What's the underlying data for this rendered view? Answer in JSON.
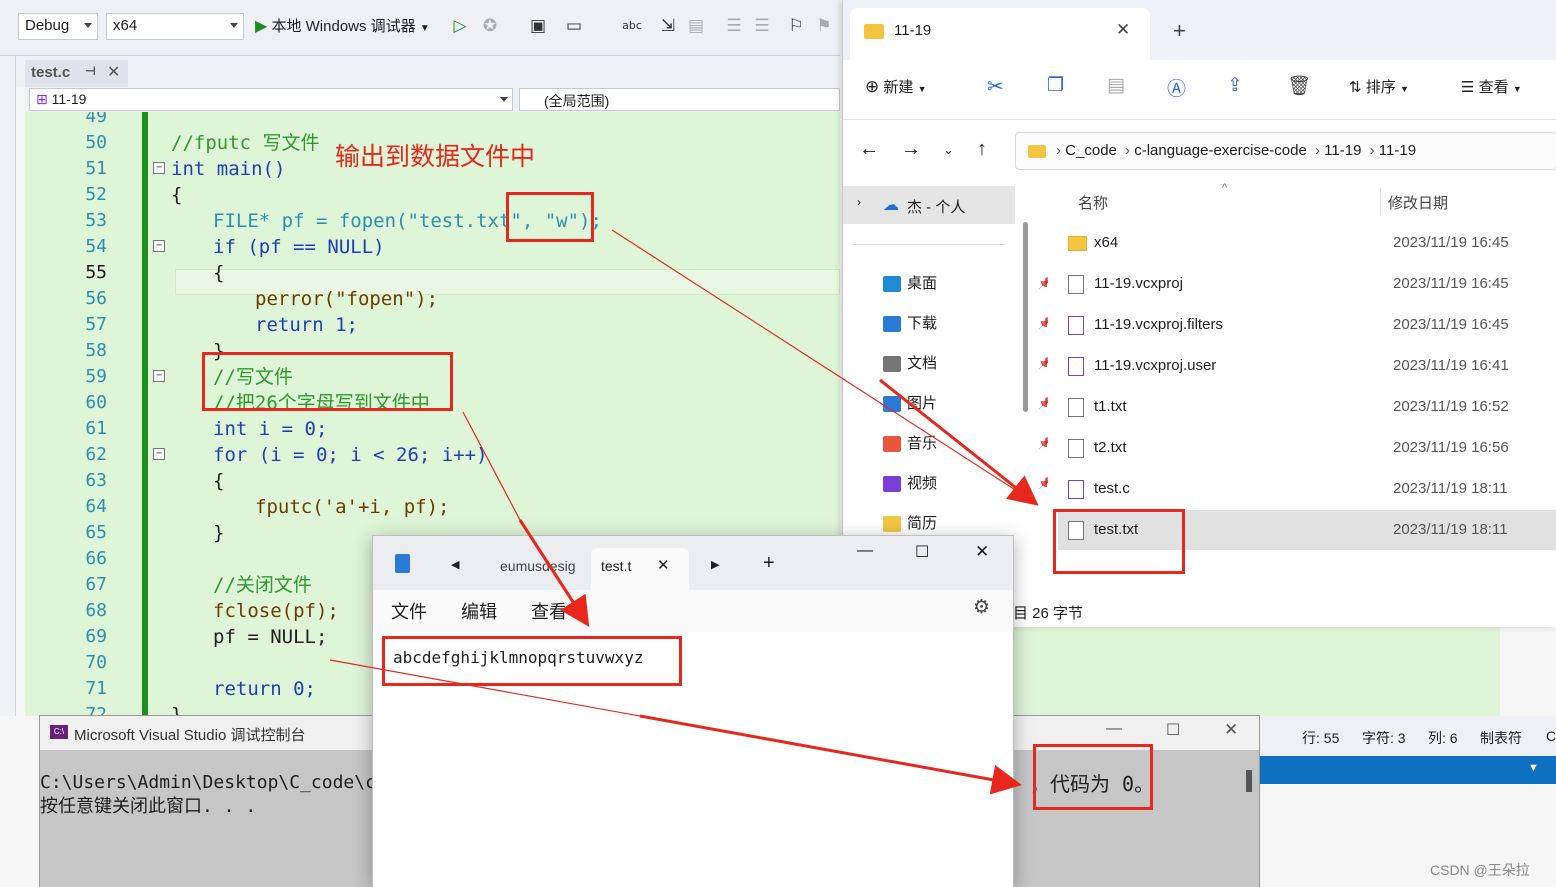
{
  "vs": {
    "config": "Debug",
    "platform": "x64",
    "debug_target": "本地 Windows 调试器",
    "file_tab": "test.c",
    "project_combo": "11-19",
    "scope_combo": "(全局范围)",
    "status": {
      "line": "行: 55",
      "char": "字符: 3",
      "col": "列: 6",
      "tabs": "制表符",
      "extra": "C"
    }
  },
  "code": {
    "lines": [
      {
        "n": "49",
        "text": ""
      },
      {
        "n": "50",
        "text": "//fputc 写文件"
      },
      {
        "n": "51",
        "text": "int main()"
      },
      {
        "n": "52",
        "text": "{"
      },
      {
        "n": "53",
        "text": "FILE* pf = fopen(\"test.txt\", \"w\");"
      },
      {
        "n": "54",
        "text": "if (pf == NULL)"
      },
      {
        "n": "55",
        "text": "{"
      },
      {
        "n": "56",
        "text": "perror(\"fopen\");"
      },
      {
        "n": "57",
        "text": "return 1;"
      },
      {
        "n": "58",
        "text": "}"
      },
      {
        "n": "59",
        "text": "//写文件"
      },
      {
        "n": "60",
        "text": "//把26个字母写到文件中"
      },
      {
        "n": "61",
        "text": "int i = 0;"
      },
      {
        "n": "62",
        "text": "for (i = 0; i < 26; i++)"
      },
      {
        "n": "63",
        "text": "{"
      },
      {
        "n": "64",
        "text": "fputc('a'+i, pf);"
      },
      {
        "n": "65",
        "text": "}"
      },
      {
        "n": "66",
        "text": ""
      },
      {
        "n": "67",
        "text": "//关闭文件"
      },
      {
        "n": "68",
        "text": "fclose(pf);"
      },
      {
        "n": "69",
        "text": "pf = NULL;"
      },
      {
        "n": "70",
        "text": ""
      },
      {
        "n": "71",
        "text": "return 0;"
      },
      {
        "n": "72",
        "text": "}"
      }
    ],
    "annotation": "输出到数据文件中"
  },
  "explorer": {
    "tab_title": "11-19",
    "new_label": "新建",
    "sort_label": "排序",
    "view_label": "查看",
    "breadcrumb": [
      "C_code",
      "c-language-exercise-code",
      "11-19",
      "11-19"
    ],
    "onedrive": "杰 - 个人",
    "nav_items": [
      {
        "label": "桌面",
        "icon": "desktop-icon"
      },
      {
        "label": "下载",
        "icon": "download-icon"
      },
      {
        "label": "文档",
        "icon": "document-icon"
      },
      {
        "label": "图片",
        "icon": "picture-icon"
      },
      {
        "label": "音乐",
        "icon": "music-icon"
      },
      {
        "label": "视频",
        "icon": "video-icon"
      },
      {
        "label": "简历",
        "icon": "folder-icon"
      }
    ],
    "col_name": "名称",
    "col_date": "修改日期",
    "files": [
      {
        "name": "x64",
        "date": "2023/11/19 16:45"
      },
      {
        "name": "11-19.vcxproj",
        "date": "2023/11/19 16:45"
      },
      {
        "name": "11-19.vcxproj.filters",
        "date": "2023/11/19 16:45"
      },
      {
        "name": "11-19.vcxproj.user",
        "date": "2023/11/19 16:41"
      },
      {
        "name": "t1.txt",
        "date": "2023/11/19 16:52"
      },
      {
        "name": "t2.txt",
        "date": "2023/11/19 16:56"
      },
      {
        "name": "test.c",
        "date": "2023/11/19 18:11"
      },
      {
        "name": "test.txt",
        "date": "2023/11/19 18:11"
      }
    ],
    "status_text": "目 26 字节"
  },
  "notepad": {
    "tab_prev": "eumusdesig",
    "tab_active": "test.t",
    "menu": [
      "文件",
      "编辑",
      "查看"
    ],
    "content": "abcdefghijklmnopqrstuvwxyz"
  },
  "console": {
    "title": "Microsoft Visual Studio 调试控制台",
    "line1": "C:\\Users\\Admin\\Desktop\\C_code\\c-la",
    "line2": "按任意键关闭此窗口. . .",
    "tail": "，代码为 0。"
  },
  "watermark": "CSDN @王朵拉"
}
